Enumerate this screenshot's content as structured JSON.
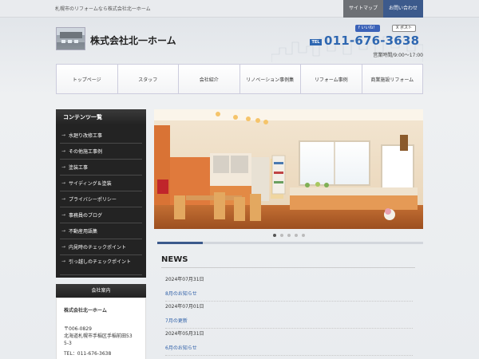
{
  "topbar": {
    "tagline": "札幌市のリフォームなら株式会社北一ホーム",
    "links": [
      "サイトマップ",
      "お問い合わせ"
    ]
  },
  "header": {
    "title": "株式会社北一ホーム",
    "sns": {
      "like": "f いいね！",
      "post": "X ポスト"
    },
    "tel_label": "TEL",
    "tel": "011-676-3638",
    "hours": "営業時間/9:00〜17:00"
  },
  "nav": [
    "トップページ",
    "スタッフ",
    "会社紹介",
    "リノベーション事例集",
    "リフォーム事例",
    "商業施設リフォーム"
  ],
  "sidebar": {
    "heading": "コンテンツ一覧",
    "items": [
      "水廻り改修工事",
      "その他施工事例",
      "塗装工事",
      "サイディング＆塗装",
      "プライバシーポリシー",
      "事務員のブログ",
      "不動産用語集",
      "内見時のチェックポイント",
      "引っ越しのチェックポイント"
    ],
    "arrow": "→"
  },
  "company": {
    "heading": "会社案内",
    "name": "株式会社北一ホーム",
    "postal": "〒006-0829",
    "address1": "北海道札幌市手稲区手稲前田53",
    "address2": "5-3",
    "tel": "TEL：011-676-3638"
  },
  "slider": {
    "slide_count": 5,
    "active": 1
  },
  "news": {
    "heading": "NEWS",
    "items": [
      {
        "date": "2024年07月31日",
        "title": "8月のお知らせ"
      },
      {
        "date": "2024年07月01日",
        "title": "7月の更新"
      },
      {
        "date": "2024年05月31日",
        "title": "6月のお知らせ"
      }
    ]
  },
  "colors": {
    "accent": "#2e67b1",
    "dark": "#232323",
    "contact": "#3c5a8c"
  }
}
